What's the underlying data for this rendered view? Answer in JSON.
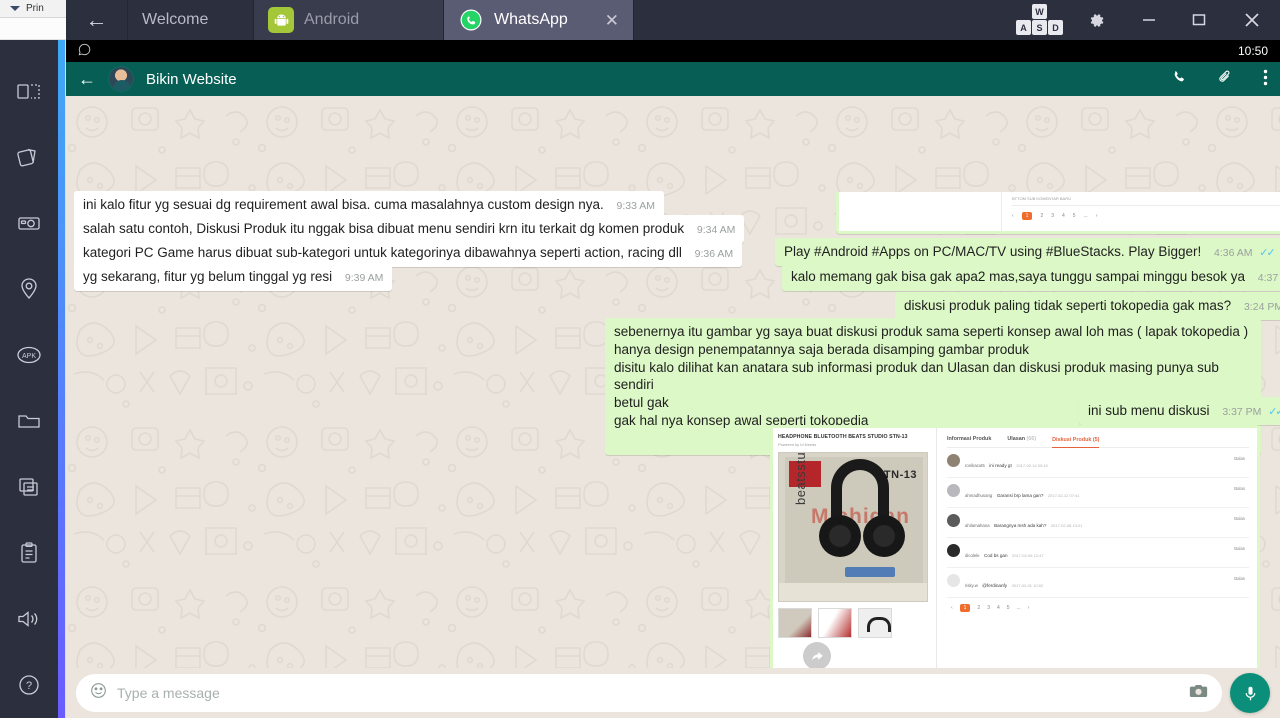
{
  "background_app": {
    "toolbar_label": "Prin"
  },
  "titlebar": {
    "back_arrow": "←",
    "tabs": [
      {
        "label": "Welcome",
        "icon": "",
        "active": false
      },
      {
        "label": "Android",
        "icon": "android-icon",
        "active": false
      },
      {
        "label": "WhatsApp",
        "icon": "whatsapp-icon",
        "active": true,
        "close": "✕"
      }
    ],
    "wasd": {
      "w": "W",
      "a": "A",
      "s": "S",
      "d": "D"
    },
    "settings_icon": "⚙",
    "minimize_icon": "—",
    "maximize_icon": "☐",
    "close_icon": "✕"
  },
  "statusbar": {
    "app_icon": "✆",
    "time": "10:50"
  },
  "chat_header": {
    "back_icon": "←",
    "title": "Bikin Website",
    "call_icon": "✆",
    "attach_icon": "ὌE",
    "menu_icon": "⋮"
  },
  "messages": [
    {
      "id": "m1",
      "dir": "out",
      "text": "Play #Android #Apps on PC/MAC/TV using #BlueStacks. Play Bigger!",
      "time": "4:36 AM",
      "ticks": "✓✓"
    },
    {
      "id": "m2",
      "dir": "out",
      "text": "kalo memang gak bisa gak apa2 mas,saya tunggu sampai minggu besok ya",
      "time": "4:37 AM",
      "ticks": "✓✓"
    },
    {
      "id": "m3",
      "dir": "in",
      "text": "ini kalo fitur yg sesuai dg requirement awal bisa. cuma masalahnya custom design nya.",
      "time": "9:33 AM"
    },
    {
      "id": "m4",
      "dir": "in",
      "text": "salah satu contoh, Diskusi Produk itu nggak bisa dibuat menu sendiri krn itu terkait dg komen produk",
      "time": "9:34 AM"
    },
    {
      "id": "m5",
      "dir": "in",
      "text": "kategori PC Game harus dibuat sub-kategori untuk kategorinya dibawahnya seperti action, racing dll",
      "time": "9:36 AM"
    },
    {
      "id": "m6",
      "dir": "in",
      "text": "yg sekarang, fitur yg belum tinggal yg resi",
      "time": "9:39 AM"
    },
    {
      "id": "m7",
      "dir": "out",
      "text": "diskusi produk paling tidak seperti tokopedia gak mas?",
      "time": "3:24 PM",
      "ticks": "✓✓"
    },
    {
      "id": "m8",
      "dir": "out",
      "lines": [
        "sebenernya itu gambar yg saya buat diskusi produk sama seperti konsep awal loh mas ( lapak tokopedia )",
        "hanya design penempatannya saja berada disamping gambar produk",
        "disitu kalo dilihat kan anatara sub informasi produk dan Ulasan dan diskusi produk masing punya sub sendiri",
        "betul gak",
        "gak hal nya konsep awal seperti tokopedia"
      ],
      "time": "3:37 PM",
      "ticks": "✓✓"
    },
    {
      "id": "m9",
      "dir": "out",
      "text": "ini sub menu diskusi",
      "time": "3:37 PM",
      "ticks": "✓✓"
    }
  ],
  "attachment": {
    "product_title": "HEADPHONE BLUETOOTH BEATS STUDIO STN-13",
    "product_sub": "Powered by Id Needs",
    "model_label": "STN-13",
    "brand_text": "beatsstudio",
    "watermark": "Michigan",
    "bluetooth_label": "Bluetooth",
    "tabs": [
      {
        "label": "Informasi Produk",
        "count": "",
        "active": false
      },
      {
        "label": "Ulasan",
        "count": "(66)",
        "active": false
      },
      {
        "label": "Diskusi Produk (5)",
        "count": "",
        "active": true
      }
    ],
    "discussions": [
      {
        "name": "ronikacut5",
        "message": "ini ready gt",
        "date": "2017-02-14 09:10",
        "reply": "Balas"
      },
      {
        "name": "ahmadhusang",
        "message": "Garansi brp lama gan?",
        "date": "2017-02-12 07:41",
        "reply": "Balas"
      },
      {
        "name": "ahilamahana",
        "message": "Barangnya msh ada kah?",
        "date": "2017-02-08 13:21",
        "reply": "Balas"
      },
      {
        "name": "dicolele",
        "message": "Cod bs gan",
        "date": "2017-02-06 12:47",
        "reply": "Balas"
      },
      {
        "name": "risky.w",
        "message": "@ferdinanfy",
        "date": "2017-02-01 10:02",
        "reply": "Balas"
      }
    ],
    "pagination": [
      "‹",
      "1",
      "2",
      "3",
      "4",
      "5",
      "...",
      "›"
    ],
    "pagination_current": "1"
  },
  "prev_attachment": {
    "faint_line": "BTTOM SUB KOMENTAR BARU",
    "pagination": [
      "‹",
      "1",
      "2",
      "3",
      "4",
      "5",
      "...",
      "›"
    ],
    "pagination_current": "1"
  },
  "chat_controls": {
    "forward_icon": "➦",
    "scroll_down_icon": "»"
  },
  "input_bar": {
    "emoji_icon": "☺",
    "placeholder": "Type a message",
    "value": "",
    "camera_icon": "☐",
    "mic_icon": "⬤"
  },
  "sidebar": {
    "items": [
      {
        "name": "fullscreen-icon",
        "label": "Fullscreen"
      },
      {
        "name": "shake-icon",
        "label": "Shake"
      },
      {
        "name": "screenshot-icon",
        "label": "Screenshot"
      },
      {
        "name": "location-icon",
        "label": "Location"
      },
      {
        "name": "apk-icon",
        "label": "APK"
      },
      {
        "name": "folder-icon",
        "label": "Media Manager"
      },
      {
        "name": "copy-icon",
        "label": "Copy"
      },
      {
        "name": "paste-icon",
        "label": "Paste"
      },
      {
        "name": "volume-icon",
        "label": "Volume"
      },
      {
        "name": "help-icon",
        "label": "Help"
      }
    ]
  },
  "colors": {
    "whatsapp_teal": "#075e54",
    "outgoing_bubble": "#dcf8c6",
    "incoming_bubble": "#ffffff",
    "chat_bg": "#ece5dd",
    "bluestacks_dark": "#2c2f3e",
    "accent_orange": "#ef6c2c"
  }
}
